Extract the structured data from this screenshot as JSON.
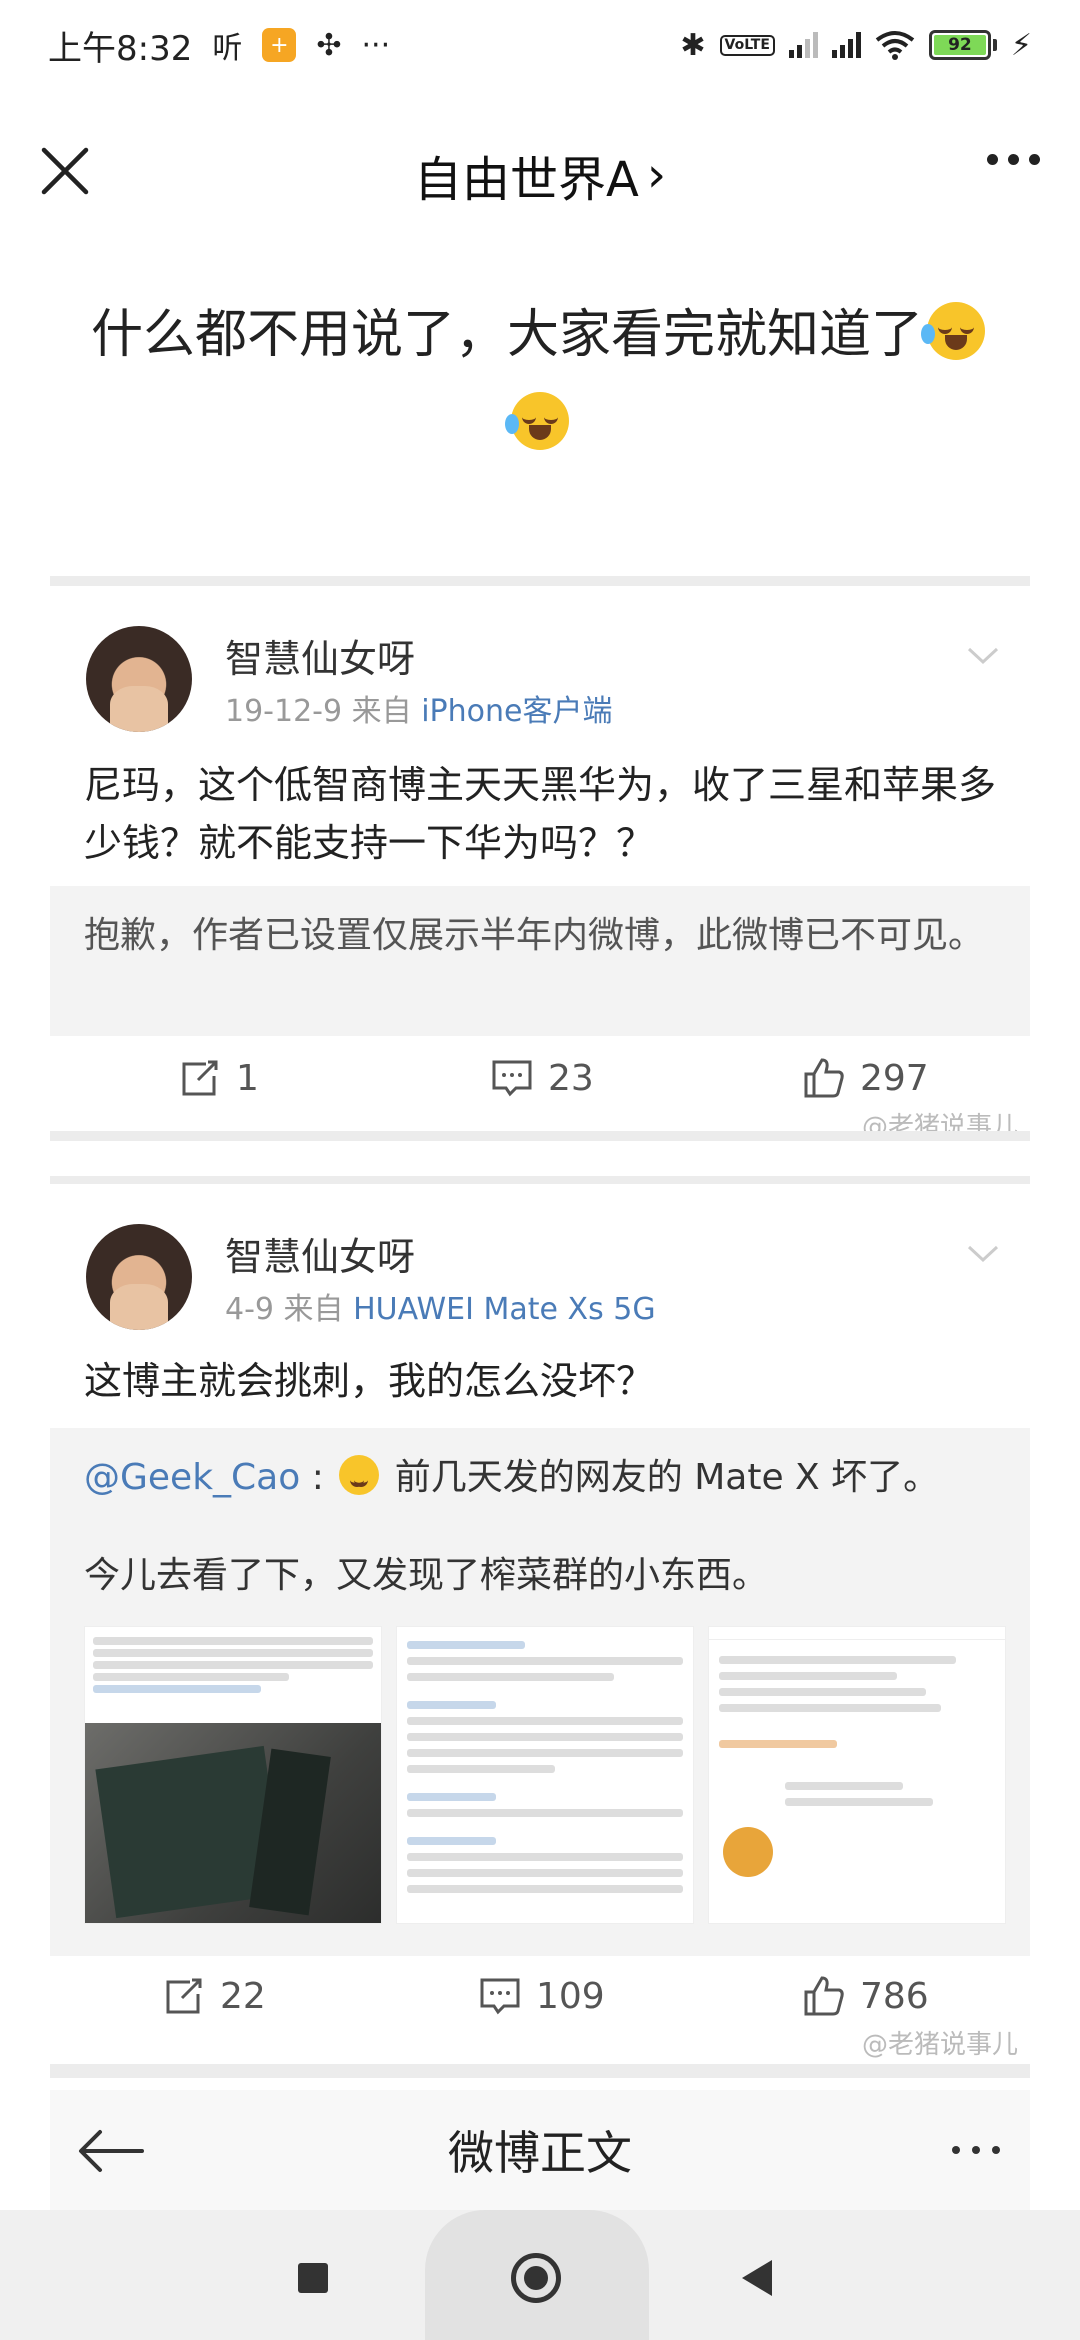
{
  "status_bar": {
    "time": "上午8:32",
    "hear_icon": "听",
    "app_icon": "+",
    "fan_icon": "✣",
    "more": "···",
    "bluetooth_icon": "✱",
    "volte": "VoLTE",
    "battery": "92",
    "charging_icon": "⚡"
  },
  "header": {
    "title": "自由世界A",
    "title_chevron": "›"
  },
  "headline": {
    "text": "什么都不用说了，大家看完就知道了"
  },
  "posts": [
    {
      "username": "智慧仙女呀",
      "date": "19-12-9",
      "source_prefix": "来自",
      "source": "iPhone客户端",
      "text": "尼玛，这个低智商博主天天黑华为，收了三星和苹果多少钱？就不能支持一下华为吗？？",
      "quote_text": "抱歉，作者已设置仅展示半年内微博，此微博已不可见。",
      "reposts": "1",
      "comments": "23",
      "likes": "297",
      "watermark": "@老猪说事儿"
    },
    {
      "username": "智慧仙女呀",
      "date": "4-9",
      "source_prefix": "来自",
      "source": "HUAWEI Mate Xs 5G",
      "text": "这博主就会挑刺，我的怎么没坏？",
      "quote_mention": "@Geek_Cao",
      "quote_colon": ":",
      "quote_line1": "前几天发的网友的 Mate X 坏了。",
      "quote_line2": "今儿去看了下，又发现了榨菜群的小东西。",
      "reposts": "22",
      "comments": "109",
      "likes": "786",
      "watermark": "@老猪说事儿"
    }
  ],
  "bottom_bar": {
    "title": "微博正文"
  },
  "colors": {
    "link": "#4a7bb7",
    "meta": "#999999",
    "quote_bg": "#f3f3f3"
  }
}
